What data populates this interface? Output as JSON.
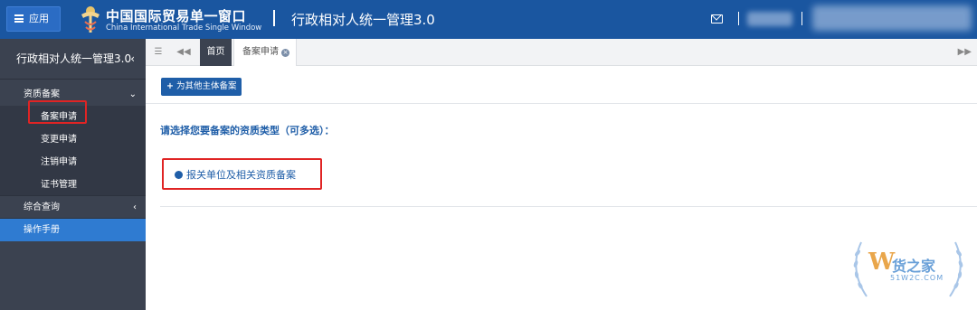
{
  "topbar": {
    "menu_label": "应用",
    "brand_cn": "中国国际贸易单一窗口",
    "brand_en": "China International Trade Single Window",
    "system_title": "行政相对人统一管理3.0"
  },
  "sidebar": {
    "header": "行政相对人统一管理3.0",
    "groups": [
      {
        "label": "资质备案",
        "items": [
          "备案申请",
          "变更申请",
          "注销申请",
          "证书管理"
        ]
      },
      {
        "label": "综合查询"
      },
      {
        "label": "操作手册"
      }
    ]
  },
  "tabs": {
    "home": "首页",
    "current": "备案申请"
  },
  "main": {
    "add_button": "为其他主体备案",
    "prompt": "请选择您要备案的资质类型（可多选）：",
    "option": "报关单位及相关资质备案"
  },
  "watermark": {
    "text": "货之家",
    "url": "51W2C.COM"
  },
  "colors": {
    "topbar": "#1a56a0",
    "sidebar": "#3b4250",
    "accent": "#2f7bd1",
    "highlight_box": "#e02424"
  }
}
